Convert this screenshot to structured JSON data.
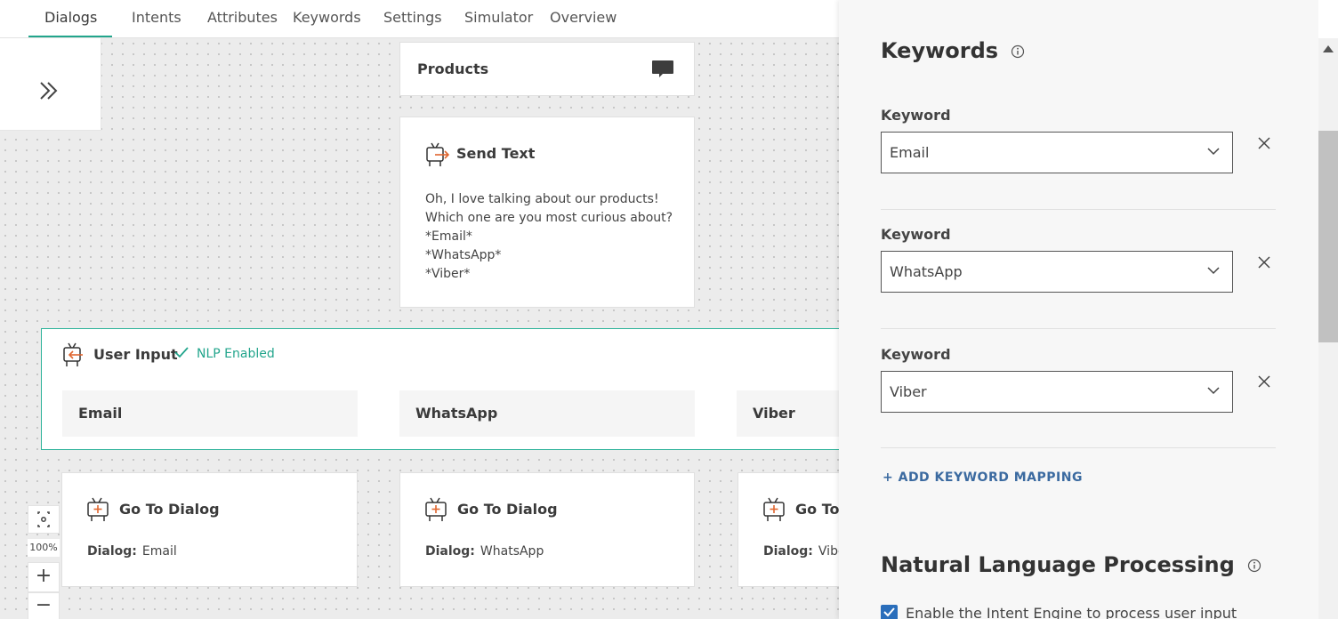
{
  "nav": {
    "tabs": [
      {
        "label": "Dialogs",
        "active": true
      },
      {
        "label": "Intents"
      },
      {
        "label": "Attributes"
      },
      {
        "label": "Keywords"
      },
      {
        "label": "Settings"
      },
      {
        "label": "Simulator"
      },
      {
        "label": "Overview"
      }
    ],
    "accent_color": "#22a58c"
  },
  "canvas": {
    "products_card": {
      "title": "Products",
      "icon": "chat-bubble-icon"
    },
    "send_text": {
      "title": "Send Text",
      "body": "Oh, I love talking about our products!\nWhich one are you most curious about?\n*Email*\n*WhatsApp*\n*Viber*"
    },
    "user_input": {
      "title": "User Input",
      "nlp_label": "NLP Enabled",
      "keywords": [
        "Email",
        "WhatsApp",
        "Viber"
      ]
    },
    "goto_cards": [
      {
        "title": "Go To Dialog",
        "dialog_label": "Dialog:",
        "dialog_value": "Email"
      },
      {
        "title": "Go To Dialog",
        "dialog_label": "Dialog:",
        "dialog_value": "WhatsApp"
      },
      {
        "title": "Go To",
        "dialog_label": "Dialog:",
        "dialog_value": "Vibe"
      }
    ],
    "zoom": {
      "level": "100%"
    }
  },
  "panel": {
    "keywords_heading": "Keywords",
    "keyword_rows": [
      {
        "label": "Keyword",
        "value": "Email"
      },
      {
        "label": "Keyword",
        "value": "WhatsApp"
      },
      {
        "label": "Keyword",
        "value": "Viber"
      }
    ],
    "add_mapping": "+ ADD KEYWORD MAPPING",
    "nlp_heading": "Natural Language Processing",
    "intent_engine_label": "Enable the Intent Engine to process user input",
    "intent_engine_checked": true
  }
}
